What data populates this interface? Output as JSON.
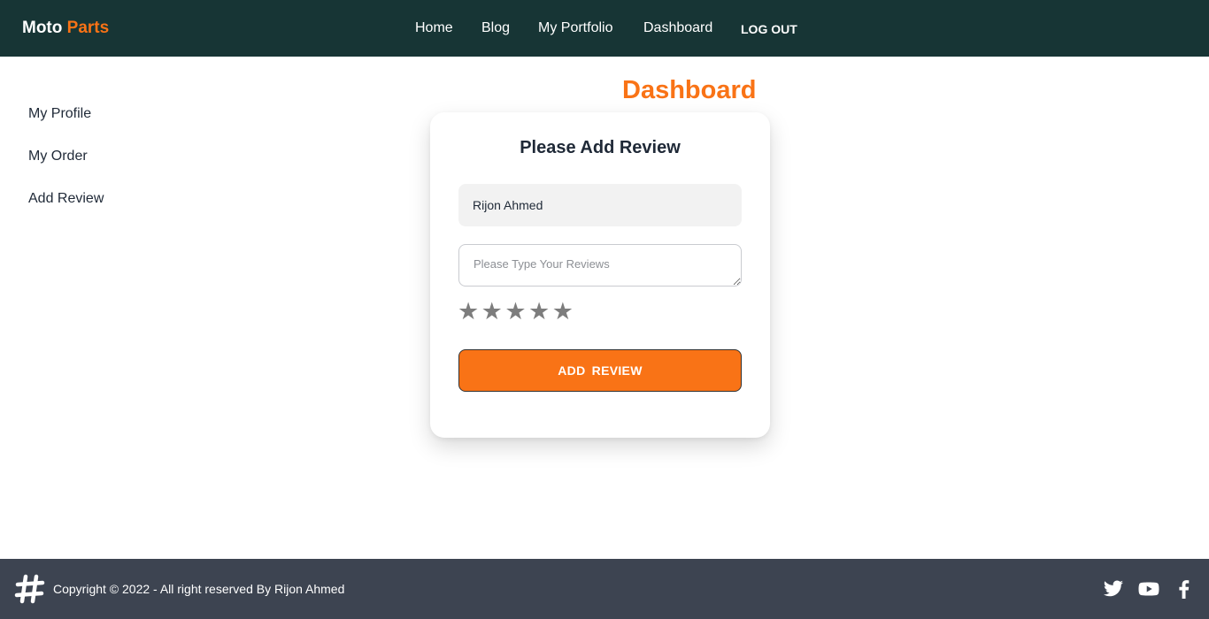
{
  "brand": {
    "primary": "Moto",
    "accent": "Parts"
  },
  "nav": {
    "home": "Home",
    "blog": "Blog",
    "portfolio": "My Portfolio",
    "dashboard": "Dashboard",
    "logout": "LOG OUT"
  },
  "sidebar": {
    "items": [
      {
        "label": "My Profile"
      },
      {
        "label": "My Order"
      },
      {
        "label": "Add Review"
      }
    ]
  },
  "main": {
    "title": "Dashboard",
    "card": {
      "title": "Please Add Review",
      "name_value": "Rijon Ahmed",
      "review_placeholder": "Please Type Your Reviews",
      "rating": {
        "value": 0,
        "max": 5,
        "star_glyph": "★"
      },
      "submit_label": "ADD  REVIEW"
    }
  },
  "footer": {
    "copyright": "Copyright © 2022 - All right reserved By Rijon Ahmed",
    "social_icons": [
      "twitter-icon",
      "youtube-icon",
      "facebook-icon"
    ]
  },
  "colors": {
    "navbar_bg": "#173535",
    "accent": "#f97316",
    "footer_bg": "#3d4451",
    "star": "#7d7d7d"
  }
}
